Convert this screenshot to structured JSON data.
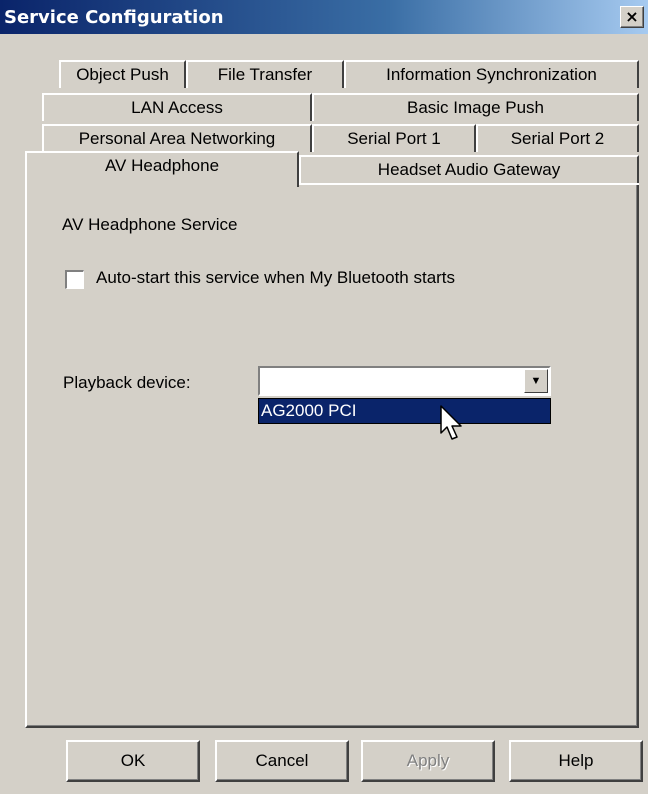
{
  "window": {
    "title": "Service Configuration",
    "close_label": "×"
  },
  "tabs": {
    "row1": [
      "Object Push",
      "File Transfer",
      "Information Synchronization"
    ],
    "row2": [
      "LAN Access",
      "Basic Image Push"
    ],
    "row3": [
      "Personal Area Networking",
      "Serial Port 1",
      "Serial Port 2"
    ],
    "row4": [
      "AV Headphone",
      "Headset Audio Gateway"
    ],
    "active": "AV Headphone"
  },
  "panel": {
    "service_title": "AV Headphone Service",
    "autostart_label": "Auto-start this service when My Bluetooth starts",
    "autostart_checked": false,
    "playback_label": "Playback device:",
    "playback_value": "",
    "dropdown_options": [
      "AG2000 PCI"
    ],
    "dropdown_arrow": "▼"
  },
  "buttons": {
    "ok": "OK",
    "cancel": "Cancel",
    "apply": "Apply",
    "help": "Help"
  },
  "icons": {
    "close": "close-icon",
    "dropdown": "chevron-down-icon",
    "cursor": "mouse-pointer-icon"
  }
}
